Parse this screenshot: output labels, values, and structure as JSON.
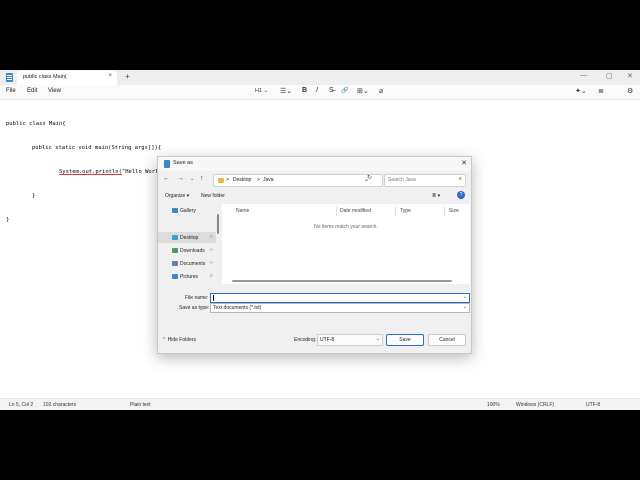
{
  "window": {
    "tab_title": "public class Main{",
    "tab_close": "×",
    "new_tab": "+",
    "controls": [
      "—",
      "▢",
      "✕"
    ]
  },
  "menu": {
    "file": "File",
    "edit": "Edit",
    "view": "View",
    "heading_select": "H1 ⌄",
    "tools": [
      "☰⌄",
      "B",
      "I",
      "S̶",
      "🔗",
      "⊞⌄",
      "⌀"
    ],
    "right_tools": [
      "✦⌄",
      "≣",
      "⚙"
    ]
  },
  "editor": {
    "line1": "public class Main{",
    "line2": "public static void main(String args[]){",
    "line3_pre": "System.out.println(",
    "line3_post": "\"Hello World!\");",
    "line4": "}",
    "line5": "}"
  },
  "status": {
    "position": "Ln 5, Col 2",
    "chars": "102 characters",
    "format": "Plain text",
    "zoom": "100%",
    "line_ending": "Windows (CRLF)",
    "encoding": "UTF-8"
  },
  "dialog": {
    "title": "Save as",
    "close": "✕",
    "breadcrumb": [
      "Desktop",
      "Java"
    ],
    "crumb_sep": ">",
    "search_placeholder": "Search Java",
    "organize": "Organize ▾",
    "new_folder": "New folder",
    "view_toggle": "≣ ▾",
    "help": "?",
    "left_nav": [
      {
        "label": "Gallery",
        "color": "#3a86c8"
      },
      {
        "label": "Desktop",
        "color": "#3aa0d8",
        "pin": "📌"
      },
      {
        "label": "Downloads",
        "color": "#4a9a5a",
        "pin": "📌"
      },
      {
        "label": "Documents",
        "color": "#6a7ea8",
        "pin": "📌"
      },
      {
        "label": "Pictures",
        "color": "#3a86c8",
        "pin": "📌"
      }
    ],
    "columns": [
      "Name",
      "Date modified",
      "Type",
      "Size"
    ],
    "empty_message": "No items match your search.",
    "file_name_label": "File name:",
    "file_name_value": "",
    "save_as_type_label": "Save as type:",
    "save_as_type_value": "Text documents (*.txt)",
    "hide_folders": "Hide Folders",
    "encoding_label": "Encoding:",
    "encoding_value": "UTF-8",
    "save_button": "Save",
    "cancel_button": "Cancel"
  }
}
